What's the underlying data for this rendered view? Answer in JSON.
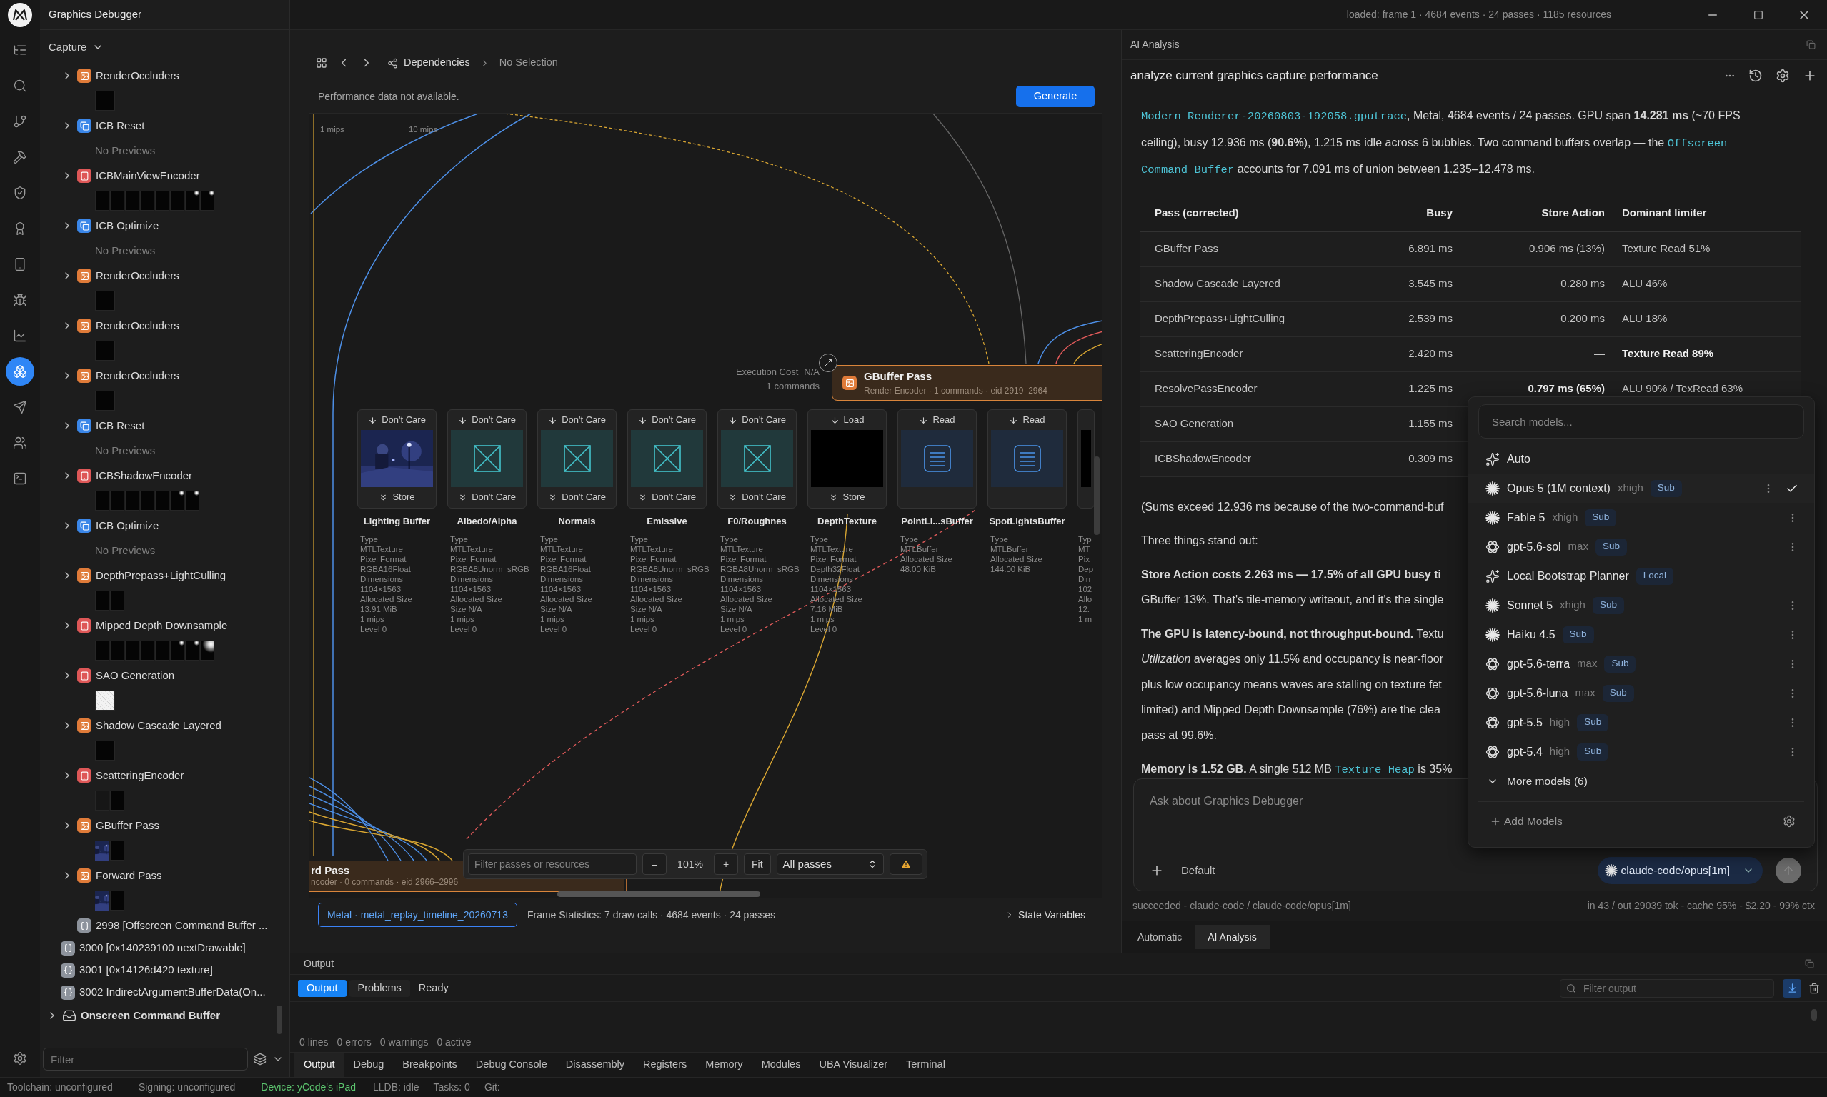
{
  "title_bar": {
    "app_title": "Graphics Debugger",
    "status": "loaded: frame 1 · 4684 events · 24 passes · 1185 resources"
  },
  "activity_bar": [
    {
      "selected": false
    },
    {
      "selected": false
    },
    {
      "selected": false
    },
    {
      "selected": false
    },
    {
      "selected": false
    },
    {
      "selected": false
    },
    {
      "selected": false
    },
    {
      "selected": false
    },
    {
      "selected": false
    },
    {
      "selected": true
    },
    {
      "selected": false
    },
    {
      "selected": false
    },
    {
      "selected": false
    }
  ],
  "sidebar": {
    "section": "Capture",
    "expanded": true,
    "passes": [
      {
        "name": "RenderOccluders",
        "kind": "render",
        "expanded": false,
        "thumbs": [
          {
            "kind": "dark"
          }
        ]
      },
      {
        "name": "ICB Reset",
        "kind": "icb",
        "expanded": false,
        "note": "No Previews"
      },
      {
        "name": "ICBMainViewEncoder",
        "kind": "compute",
        "expanded": false,
        "thumbs": [
          {
            "kind": "dark"
          },
          {
            "kind": "dark"
          },
          {
            "kind": "dark"
          },
          {
            "kind": "dark"
          },
          {
            "kind": "dark"
          },
          {
            "kind": "dark"
          },
          {
            "kind": "glint"
          },
          {
            "kind": "glint"
          }
        ]
      },
      {
        "name": "ICB Optimize",
        "kind": "icb",
        "expanded": false,
        "note": "No Previews"
      },
      {
        "name": "RenderOccluders",
        "kind": "render",
        "expanded": false,
        "thumbs": [
          {
            "kind": "dark"
          }
        ]
      },
      {
        "name": "RenderOccluders",
        "kind": "render",
        "expanded": false,
        "thumbs": [
          {
            "kind": "dark"
          }
        ]
      },
      {
        "name": "RenderOccluders",
        "kind": "render",
        "expanded": false,
        "thumbs": [
          {
            "kind": "dark"
          }
        ]
      },
      {
        "name": "ICB Reset",
        "kind": "icb",
        "expanded": false,
        "note": "No Previews"
      },
      {
        "name": "ICBShadowEncoder",
        "kind": "compute",
        "expanded": false,
        "thumbs": [
          {
            "kind": "dark"
          },
          {
            "kind": "dark"
          },
          {
            "kind": "dark"
          },
          {
            "kind": "dark"
          },
          {
            "kind": "dark"
          },
          {
            "kind": "glint"
          },
          {
            "kind": "glint"
          }
        ]
      },
      {
        "name": "ICB Optimize",
        "kind": "icb",
        "expanded": false,
        "note": "No Previews"
      },
      {
        "name": "DepthPrepass+LightCulling",
        "kind": "render",
        "expanded": false,
        "thumbs": [
          {
            "kind": "dark"
          },
          {
            "kind": "dark"
          }
        ]
      },
      {
        "name": "Mipped Depth Downsample",
        "kind": "compute",
        "expanded": false,
        "thumbs": [
          {
            "kind": "dark"
          },
          {
            "kind": "dark"
          },
          {
            "kind": "dark"
          },
          {
            "kind": "dark"
          },
          {
            "kind": "dark"
          },
          {
            "kind": "glint"
          },
          {
            "kind": "glint"
          },
          {
            "kind": "bright"
          }
        ]
      },
      {
        "name": "SAO Generation",
        "kind": "compute",
        "expanded": false,
        "thumbs": [
          {
            "kind": "white"
          }
        ]
      },
      {
        "name": "Shadow Cascade Layered",
        "kind": "render",
        "expanded": false,
        "thumbs": [
          {
            "kind": "dark"
          }
        ]
      },
      {
        "name": "ScatteringEncoder",
        "kind": "compute",
        "expanded": false,
        "thumbs": [
          {
            "kind": "faint"
          },
          {
            "kind": "dark"
          }
        ]
      },
      {
        "name": "GBuffer Pass",
        "kind": "render",
        "expanded": false,
        "thumbs": [
          {
            "kind": "scene"
          },
          {
            "kind": "dark"
          }
        ]
      },
      {
        "name": "Forward Pass",
        "kind": "render",
        "expanded": false,
        "thumbs": [
          {
            "kind": "scene"
          },
          {
            "kind": "dark"
          }
        ]
      },
      {
        "name": "2998 [Offscreen Command Buffer ...",
        "kind": "call"
      }
    ],
    "calls": [
      "3000 [0x140239100 nextDrawable]",
      "3001 [0x14126d420 texture]",
      "3002 IndirectArgumentBufferData(On..."
    ],
    "buffers": [
      {
        "name": "Onscreen Command Buffer",
        "expanded": false
      }
    ],
    "filter_placeholder": "Filter"
  },
  "center": {
    "breadcrumb": {
      "section": "Dependencies",
      "selection": "No Selection"
    },
    "performance_note": "Performance data not available.",
    "generate_button": "Generate",
    "graph": {
      "top_labels": [
        "1 mips",
        "10 mips"
      ],
      "pass_node": {
        "execution_cost_label": "Execution Cost",
        "execution_cost": "N/A",
        "commands": "1 commands",
        "title": "GBuffer Pass",
        "subtitle": "Render Encoder · 1 commands · eid 2919–2964"
      },
      "attachments": [
        {
          "name": "Lighting Buffer",
          "load": "Don't Care",
          "store": "Store",
          "preview": {
            "kind": "scene"
          },
          "props": [
            "Type",
            "MTLTexture",
            "Pixel Format",
            "RGBA16Float",
            "Dimensions",
            "1104×1563",
            "Allocated Size",
            "13.91 MiB",
            "1 mips",
            "Level 0"
          ]
        },
        {
          "name": "Albedo/Alpha",
          "load": "Don't Care",
          "store": "Don't Care",
          "preview": {
            "kind": "placeholder"
          },
          "props": [
            "Type",
            "MTLTexture",
            "Pixel Format",
            "RGBA8Unorm_sRGB",
            "Dimensions",
            "1104×1563",
            "Allocated Size",
            "Size N/A",
            "1 mips",
            "Level 0"
          ]
        },
        {
          "name": "Normals",
          "load": "Don't Care",
          "store": "Don't Care",
          "preview": {
            "kind": "placeholder"
          },
          "props": [
            "Type",
            "MTLTexture",
            "Pixel Format",
            "RGBA16Float",
            "Dimensions",
            "1104×1563",
            "Allocated Size",
            "Size N/A",
            "1 mips",
            "Level 0"
          ]
        },
        {
          "name": "Emissive",
          "load": "Don't Care",
          "store": "Don't Care",
          "preview": {
            "kind": "placeholder"
          },
          "props": [
            "Type",
            "MTLTexture",
            "Pixel Format",
            "RGBA8Unorm_sRGB",
            "Dimensions",
            "1104×1563",
            "Allocated Size",
            "Size N/A",
            "1 mips",
            "Level 0"
          ]
        },
        {
          "name": "F0/Roughnes",
          "load": "Don't Care",
          "store": "Don't Care",
          "preview": {
            "kind": "placeholder"
          },
          "props": [
            "Type",
            "MTLTexture",
            "Pixel Format",
            "RGBA8Unorm_sRGB",
            "Dimensions",
            "1104×1563",
            "Allocated Size",
            "Size N/A",
            "1 mips",
            "Level 0"
          ]
        },
        {
          "name": "DepthTexture",
          "load": "Load",
          "store": "Store",
          "preview": {
            "kind": "black"
          },
          "props": [
            "Type",
            "MTLTexture",
            "Pixel Format",
            "Depth32Float",
            "Dimensions",
            "1104×1563",
            "Allocated Size",
            "7.16 MiB",
            "1 mips",
            "Level 0"
          ]
        },
        {
          "name": "PointLi...sBuffer",
          "load": "Read",
          "preview": {
            "kind": "buffer"
          },
          "props": [
            "Type",
            "MTLBuffer",
            "Allocated Size",
            "48.00 KiB"
          ]
        },
        {
          "name": "SpotLightsBuffer",
          "load": "Read",
          "preview": {
            "kind": "buffer"
          },
          "props": [
            "Type",
            "MTLBuffer",
            "Allocated Size",
            "144.00 KiB"
          ]
        },
        {
          "preview": {
            "kind": "black"
          },
          "props": [
            "Typ",
            "MT",
            "Pix",
            "Dep",
            "Din",
            "102",
            "Allo",
            "12.",
            "1 m"
          ]
        }
      ],
      "bottom_node": {
        "title": "rd Pass",
        "subtitle": "ncoder · 0 commands · eid 2966–2996"
      },
      "toolbar": {
        "filter_placeholder": "Filter passes or resources",
        "zoom_out": "–",
        "zoom": "101%",
        "zoom_in": "+",
        "fit": "Fit",
        "scope": "All passes"
      }
    },
    "footer": {
      "api_badge": "Metal · metal_replay_timeline_20260713",
      "frame_stats": "Frame Statistics: 7 draw calls · 4684 events · 24 passes",
      "state_label": "State Variables"
    }
  },
  "ai_panel": {
    "header": "AI Analysis",
    "prompt": "analyze current graphics capture performance",
    "intro": [
      {
        "kind": "code",
        "text": "Modern Renderer-20260803-192058.gputrace"
      },
      {
        "kind": "text",
        "text": ", Metal, 4684 events / 24 passes. GPU span **14.281 ms** (~70 FPS ceiling), busy 12.936 ms (**90.6%**), 1.215 ms idle across 6 bubbles. Two command buffers overlap — the "
      },
      {
        "kind": "code",
        "text": "Offscreen Command Buffer"
      },
      {
        "kind": "text",
        "text": " accounts for 7.091 ms of union between 1.235–12.478 ms."
      }
    ],
    "table": {
      "columns": [
        "Pass (corrected)",
        "Busy",
        "Store Action",
        "Dominant limiter"
      ],
      "rows": [
        [
          {
            "text": "GBuffer Pass",
            "bold": false
          },
          {
            "text": "6.891 ms",
            "bold": false
          },
          {
            "text": "0.906 ms (13%)",
            "bold": false
          },
          {
            "text": "Texture Read 51%",
            "bold": false
          }
        ],
        [
          {
            "text": "Shadow Cascade Layered",
            "bold": false
          },
          {
            "text": "3.545 ms",
            "bold": false
          },
          {
            "text": "0.280 ms",
            "bold": false
          },
          {
            "text": "ALU 46%",
            "bold": false
          }
        ],
        [
          {
            "text": "DepthPrepass+LightCulling",
            "bold": false
          },
          {
            "text": "2.539 ms",
            "bold": false
          },
          {
            "text": "0.200 ms",
            "bold": false
          },
          {
            "text": "ALU 18%",
            "bold": false
          }
        ],
        [
          {
            "text": "ScatteringEncoder",
            "bold": false
          },
          {
            "text": "2.420 ms",
            "bold": false
          },
          {
            "text": "—",
            "bold": false
          },
          {
            "text": "Texture Read 89%",
            "bold": true
          }
        ],
        [
          {
            "text": "ResolvePassEncoder",
            "bold": false
          },
          {
            "text": "1.225 ms",
            "bold": false
          },
          {
            "text": "0.797 ms (65%)",
            "bold": true
          },
          {
            "text": "ALU 90% / TexRead 63%",
            "bold": false
          }
        ],
        [
          {
            "text": "SAO Generation",
            "bold": false
          },
          {
            "text": "1.155 ms",
            "bold": false
          }
        ],
        [
          {
            "text": "ICBShadowEncoder",
            "bold": false
          },
          {
            "text": "0.309 ms",
            "bold": false
          }
        ]
      ]
    },
    "paragraphs": [
      [
        {
          "kind": "text",
          "text": "(Sums exceed 12.936 ms because of the two-command-buf"
        }
      ],
      [
        {
          "kind": "text",
          "text": "Three things stand out:"
        }
      ],
      [
        {
          "kind": "text",
          "text": "**Store Action costs 2.263 ms — 17.5% of all GPU busy ti**"
        },
        {
          "kind": "break"
        },
        {
          "kind": "text",
          "text": "GBuffer 13%. That's tile-memory writeout, and it's the single"
        }
      ],
      [
        {
          "kind": "text",
          "text": "**The GPU is latency-bound, not throughput-bound.** Textu"
        },
        {
          "kind": "break"
        },
        {
          "kind": "text",
          "text": "*Utilization* averages only 11.5% and occupancy is near-floor"
        },
        {
          "kind": "break"
        },
        {
          "kind": "text",
          "text": "plus low occupancy means waves are stalling on texture fet"
        },
        {
          "kind": "break"
        },
        {
          "kind": "text",
          "text": "limited) and Mipped Depth Downsample (76%) are the clea"
        },
        {
          "kind": "break"
        },
        {
          "kind": "text",
          "text": "pass at 99.6%."
        }
      ],
      [
        {
          "kind": "text",
          "text": "**Memory is 1.52 GB.** A single 512 MB "
        },
        {
          "kind": "code",
          "text": "Texture Heap"
        },
        {
          "kind": "text",
          "text": " is 35%"
        }
      ]
    ],
    "model_menu": {
      "search_placeholder": "Search models...",
      "models": [
        {
          "kind": "sparkle",
          "name": "Auto",
          "has_menu": false,
          "selected": false
        },
        {
          "kind": "burst",
          "name": "Opus 5 (1M context)",
          "effort": "xhigh",
          "badge": "Sub",
          "has_menu": true,
          "selected": true
        },
        {
          "kind": "burst",
          "name": "Fable 5",
          "effort": "xhigh",
          "badge": "Sub",
          "has_menu": true,
          "selected": false
        },
        {
          "kind": "knot",
          "name": "gpt-5.6-sol",
          "effort": "max",
          "badge": "Sub",
          "has_menu": true,
          "selected": false
        },
        {
          "kind": "sparkle",
          "name": "Local Bootstrap Planner",
          "badge": "Local",
          "has_menu": false,
          "selected": false
        },
        {
          "kind": "burst",
          "name": "Sonnet 5",
          "effort": "xhigh",
          "badge": "Sub",
          "has_menu": true,
          "selected": false
        },
        {
          "kind": "burst",
          "name": "Haiku 4.5",
          "badge": "Sub",
          "has_menu": true,
          "selected": false
        },
        {
          "kind": "knot",
          "name": "gpt-5.6-terra",
          "effort": "max",
          "badge": "Sub",
          "has_menu": true,
          "selected": false
        },
        {
          "kind": "knot",
          "name": "gpt-5.6-luna",
          "effort": "max",
          "badge": "Sub",
          "has_menu": true,
          "selected": false
        },
        {
          "kind": "knot",
          "name": "gpt-5.5",
          "effort": "high",
          "badge": "Sub",
          "has_menu": true,
          "selected": false
        },
        {
          "kind": "knot",
          "name": "gpt-5.4",
          "effort": "high",
          "badge": "Sub",
          "has_menu": true,
          "selected": false
        }
      ],
      "more": "More models (6)",
      "add": "Add Models"
    },
    "composer": {
      "placeholder": "Ask about Graphics Debugger",
      "mode": "Default",
      "model": "claude-code/opus[1m]",
      "send_disabled": true
    },
    "run_status": "succeeded - claude-code / claude-code/opus[1m]",
    "usage": "in 43 / out 29039 tok - cache 95% - $2.20 - 99% ctx",
    "tabs": [
      {
        "label": "Automatic",
        "selected": false
      },
      {
        "label": "AI Analysis",
        "selected": true
      }
    ]
  },
  "output_panel": {
    "title": "Output",
    "tabs": [
      {
        "label": "Output",
        "selected": true
      },
      {
        "label": "Problems",
        "selected": false
      }
    ],
    "state": "Ready",
    "filter_placeholder": "Filter output",
    "counts": [
      "0 lines",
      "0 errors",
      "0 warnings",
      "0 active"
    ],
    "bottom_tabs": [
      {
        "label": "Output",
        "selected": true
      },
      {
        "label": "Debug",
        "selected": false
      },
      {
        "label": "Breakpoints",
        "selected": false
      },
      {
        "label": "Debug Console",
        "selected": false
      },
      {
        "label": "Disassembly",
        "selected": false
      },
      {
        "label": "Registers",
        "selected": false
      },
      {
        "label": "Memory",
        "selected": false
      },
      {
        "label": "Modules",
        "selected": false
      },
      {
        "label": "UBA Visualizer",
        "selected": false
      },
      {
        "label": "Terminal",
        "selected": false
      }
    ]
  },
  "status_bar": [
    {
      "text": "Toolchain: unconfigured",
      "color": "#8b8b8b"
    },
    {
      "text": "Signing: unconfigured",
      "color": "#8b8b8b"
    },
    {
      "text": "Device: yCode's iPad",
      "color": "#5cc46e"
    },
    {
      "text": "LLDB: idle",
      "color": "#8b8b8b"
    },
    {
      "text": "Tasks: 0",
      "color": "#8b8b8b"
    },
    {
      "text": "Git: —",
      "color": "#8b8b8b"
    }
  ]
}
